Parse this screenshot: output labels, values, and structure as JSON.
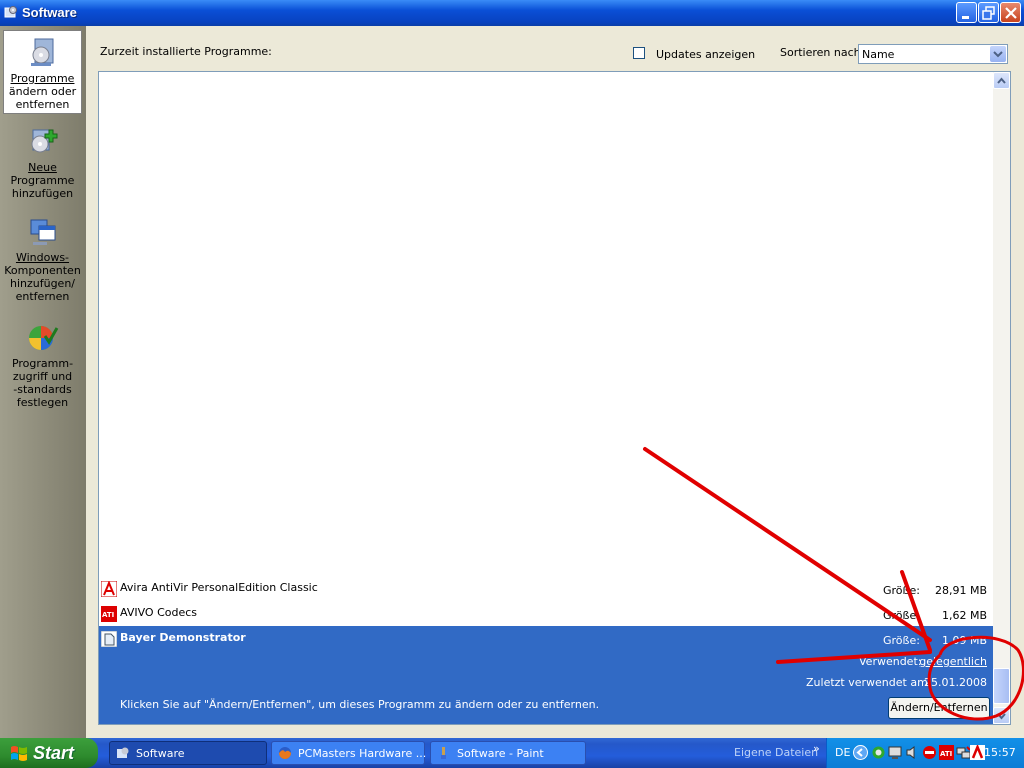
{
  "window": {
    "title": "Software",
    "controls": {
      "minimize": "minimize",
      "maximize": "restore",
      "close": "close"
    }
  },
  "sidebar": {
    "items": [
      {
        "label": "Programme ändern oder entfernen",
        "line1": "Programme",
        "line2": "ändern oder",
        "line3": "entfernen",
        "icon": "cd-box-icon",
        "selected": true
      },
      {
        "label": "Neue Programme hinzufügen",
        "line1": "Neue",
        "line2": "Programme",
        "line3": "hinzufügen",
        "icon": "cd-add-icon",
        "selected": false
      },
      {
        "label": "Windows-Komponenten hinzufügen/entfernen",
        "line1": "Windows-",
        "line2": "Komponenten",
        "line3": "hinzufügen/",
        "line4": "entfernen",
        "icon": "windows-components-icon",
        "selected": false
      },
      {
        "label": "Programmzugriff und -standards festlegen",
        "line1": "Programm-",
        "line2": "zugriff und",
        "line3": "-standards",
        "line4": "festlegen",
        "icon": "program-access-icon",
        "selected": false
      }
    ]
  },
  "main": {
    "installed_label": "Zurzeit installierte Programme:",
    "updates_checkbox_label": "Updates anzeigen",
    "updates_checked": false,
    "sort_label": "Sortieren nach:",
    "sort_value": "Name"
  },
  "programs": [
    {
      "name": "Avira AntiVir PersonalEdition Classic",
      "size_label": "Größe:",
      "size": "28,91 MB",
      "icon": "avira-icon"
    },
    {
      "name": "AVIVO Codecs",
      "size_label": "Größe:",
      "size": "1,62 MB",
      "icon": "ati-icon"
    },
    {
      "name": "Bayer Demonstrator",
      "size_label": "Größe:",
      "size": "1,09 MB",
      "used_label": "Verwendet:",
      "used_value": "gelegentlich",
      "last_used_label": "Zuletzt verwendet am:",
      "last_used_value": "25.01.2008",
      "hint": "Klicken Sie auf \"Ändern/Entfernen\", um dieses Programm zu ändern oder zu entfernen.",
      "button": "Ändern/Entfernen",
      "icon": "bayer-icon",
      "selected": true
    }
  ],
  "taskbar": {
    "start_label": "Start",
    "tasks": [
      {
        "label": "Software",
        "active": true,
        "icon": "software-icon"
      },
      {
        "label": "PCMasters Hardware ...",
        "active": false,
        "icon": "firefox-icon"
      },
      {
        "label": "Software - Paint",
        "active": false,
        "icon": "paint-icon"
      }
    ],
    "eigene_dateien": "Eigene Dateien",
    "chevron": "»",
    "language": "DE",
    "clock": "15:57"
  },
  "colors": {
    "selection": "#316AC5",
    "annotation": "#E00000",
    "titlebar": "#0A4FD6"
  }
}
